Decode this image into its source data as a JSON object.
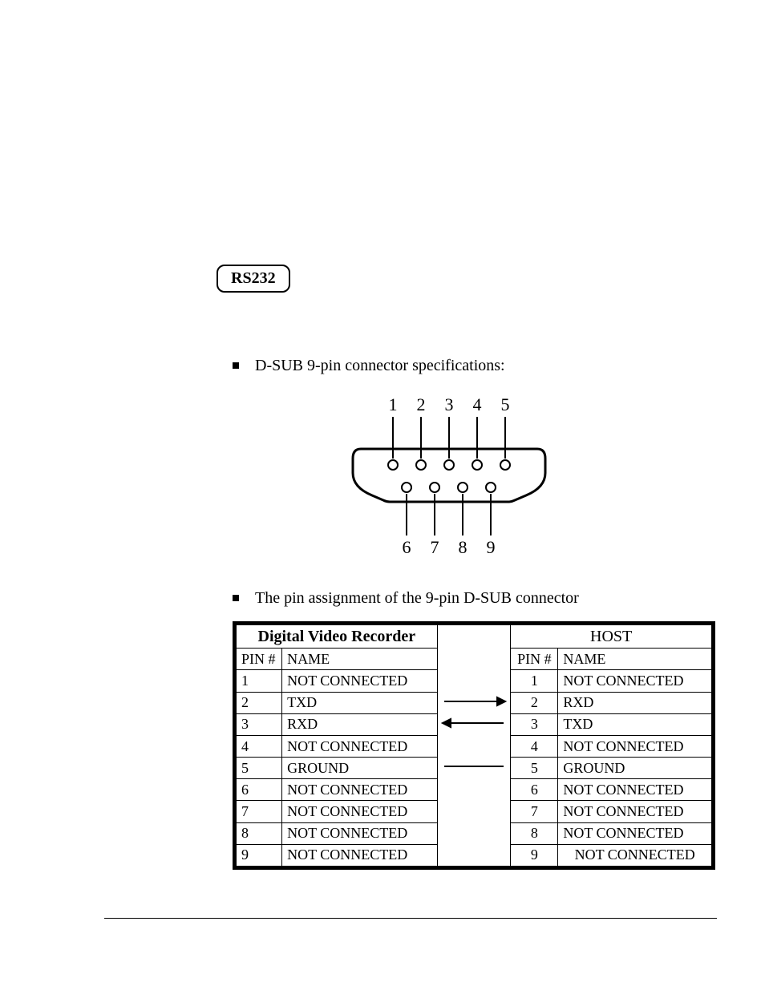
{
  "section_label": "RS232",
  "bullets": {
    "spec": "D-SUB 9-pin connector specifications:",
    "assign": "The pin assignment of the 9-pin D-SUB connector"
  },
  "diagram": {
    "top_labels": [
      "1",
      "2",
      "3",
      "4",
      "5"
    ],
    "bottom_labels": [
      "6",
      "7",
      "8",
      "9"
    ]
  },
  "table": {
    "left_title": "Digital Video Recorder",
    "right_title": "HOST",
    "col_pin": "PIN #",
    "col_name": "NAME",
    "left_rows": [
      {
        "pin": "1",
        "name": "NOT CONNECTED"
      },
      {
        "pin": "2",
        "name": "TXD"
      },
      {
        "pin": "3",
        "name": "RXD"
      },
      {
        "pin": "4",
        "name": "NOT CONNECTED"
      },
      {
        "pin": "5",
        "name": "GROUND"
      },
      {
        "pin": "6",
        "name": "NOT CONNECTED"
      },
      {
        "pin": "7",
        "name": "NOT CONNECTED"
      },
      {
        "pin": "8",
        "name": "NOT CONNECTED"
      },
      {
        "pin": "9",
        "name": "NOT CONNECTED"
      }
    ],
    "right_rows": [
      {
        "pin": "1",
        "name": "NOT CONNECTED"
      },
      {
        "pin": "2",
        "name": "RXD"
      },
      {
        "pin": "3",
        "name": "TXD"
      },
      {
        "pin": "4",
        "name": "NOT CONNECTED"
      },
      {
        "pin": "5",
        "name": "GROUND"
      },
      {
        "pin": "6",
        "name": "NOT CONNECTED"
      },
      {
        "pin": "7",
        "name": "NOT CONNECTED"
      },
      {
        "pin": "8",
        "name": "NOT CONNECTED"
      },
      {
        "pin": "9",
        "name": "NOT CONNECTED"
      }
    ],
    "connections": [
      "",
      "",
      "right",
      "left",
      "",
      "line",
      "",
      "",
      "",
      "",
      ""
    ]
  }
}
